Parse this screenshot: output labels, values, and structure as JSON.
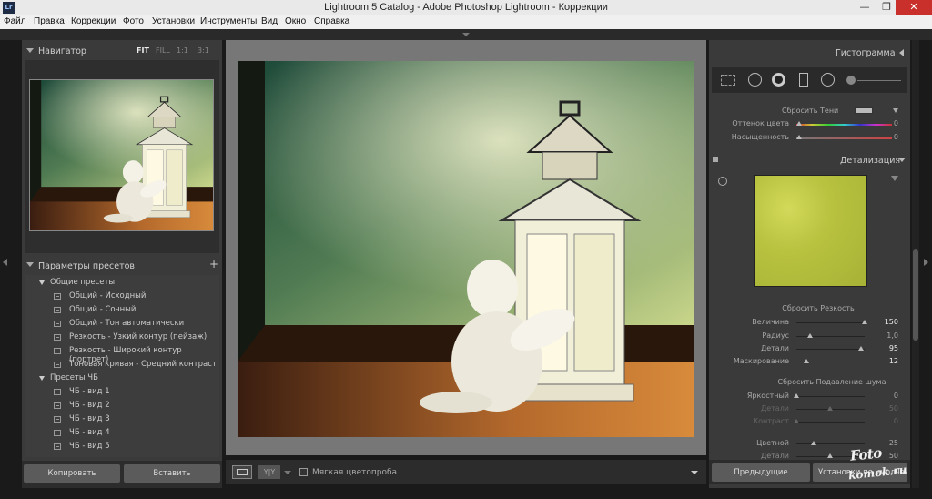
{
  "window": {
    "title": "Lightroom 5 Catalog - Adobe Photoshop Lightroom - Коррекции",
    "app_icon": "Lr"
  },
  "menu": [
    "Файл",
    "Правка",
    "Коррекции",
    "Фото",
    "Установки",
    "Инструменты",
    "Вид",
    "Окно",
    "Справка"
  ],
  "navigator": {
    "title": "Навигатор",
    "zoom": [
      "FIT",
      "FILL",
      "1:1",
      "3:1"
    ],
    "selected_zoom": "FIT"
  },
  "presets": {
    "title": "Параметры пресетов",
    "folders": [
      {
        "name": "Общие пресеты",
        "items": [
          "Общий - Исходный",
          "Общий - Сочный",
          "Общий - Тон автоматически",
          "Резкость - Узкий контур (пейзаж)",
          "Резкость - Широкий контур (портрет)",
          "Тоновая кривая - Средний контраст"
        ]
      },
      {
        "name": "Пресеты ЧБ",
        "items": [
          "ЧБ - вид 1",
          "ЧБ - вид 2",
          "ЧБ - вид 3",
          "ЧБ - вид 4",
          "ЧБ - вид 5"
        ]
      }
    ]
  },
  "left_buttons": {
    "copy": "Копировать",
    "paste": "Вставить"
  },
  "toolbar": {
    "soft_proof": "Мягкая цветопроба",
    "compare": "Y|Y"
  },
  "histogram": {
    "title": "Гистограмма"
  },
  "split_toning": {
    "reset_shadows": "Сбросить Тени",
    "hue_label": "Оттенок цвета",
    "hue_value": "0",
    "saturation_label": "Насыщенность",
    "saturation_value": "0"
  },
  "detail": {
    "title": "Детализация",
    "sharpen_reset": "Сбросить Резкость",
    "amount_label": "Величина",
    "amount_value": "150",
    "radius_label": "Радиус",
    "radius_value": "1,0",
    "detail_label": "Детали",
    "detail_value": "95",
    "masking_label": "Маскирование",
    "masking_value": "12",
    "noise_reset": "Сбросить Подавление шума",
    "lum_label": "Яркостный",
    "lum_value": "0",
    "lum_detail_label": "Детали",
    "lum_detail_value": "50",
    "contrast_label": "Контраст",
    "contrast_value": "0",
    "color_label": "Цветной",
    "color_value": "25",
    "color_detail_label": "Детали",
    "color_detail_value": "50"
  },
  "right_buttons": {
    "previous": "Предыдущие",
    "defaults": "Установки по умолчанию"
  },
  "watermark": {
    "line1": "Foto",
    "line2": "komok.ru"
  }
}
